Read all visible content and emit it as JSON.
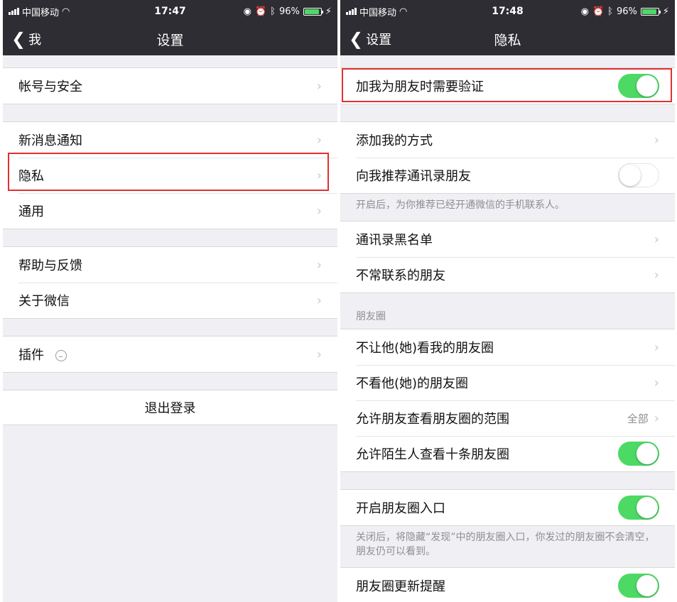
{
  "status_left": {
    "carrier": "中国移动",
    "time": "17:47",
    "battery": "96%"
  },
  "status_right": {
    "carrier": "中国移动",
    "time": "17:48",
    "battery": "96%"
  },
  "left": {
    "back_label": "我",
    "title": "设置",
    "groups": [
      [
        {
          "label": "帐号与安全"
        }
      ],
      [
        {
          "label": "新消息通知"
        },
        {
          "label": "隐私"
        },
        {
          "label": "通用"
        }
      ],
      [
        {
          "label": "帮助与反馈"
        },
        {
          "label": "关于微信"
        }
      ],
      [
        {
          "label": "插件"
        }
      ]
    ],
    "logout_label": "退出登录"
  },
  "right": {
    "back_label": "设置",
    "title": "隐私",
    "add_verify": {
      "label": "加我为朋友时需要验证",
      "on": true
    },
    "add_methods": {
      "label": "添加我的方式"
    },
    "recommend_contacts": {
      "label": "向我推荐通讯录朋友",
      "on": false
    },
    "recommend_note": "开启后，为你推荐已经开通微信的手机联系人。",
    "blacklist": {
      "label": "通讯录黑名单"
    },
    "rare_contacts": {
      "label": "不常联系的朋友"
    },
    "moments_header": "朋友圈",
    "block_view": {
      "label": "不让他(她)看我的朋友圈"
    },
    "hide_moments": {
      "label": "不看他(她)的朋友圈"
    },
    "moments_range": {
      "label": "允许朋友查看朋友圈的范围",
      "value": "全部"
    },
    "stranger_view": {
      "label": "允许陌生人查看十条朋友圈",
      "on": true
    },
    "moments_entry": {
      "label": "开启朋友圈入口",
      "on": true
    },
    "moments_entry_note": "关闭后，将隐藏“发现”中的朋友圈入口，你发过的朋友圈不会清空，朋友仍可以看到。",
    "moments_updates": {
      "label": "朋友圈更新提醒",
      "on": true
    }
  },
  "colors": {
    "nav_bg": "#2e2d33",
    "toggle_on": "#4cd964",
    "highlight": "#e03030",
    "page_bg": "#efeff4"
  }
}
